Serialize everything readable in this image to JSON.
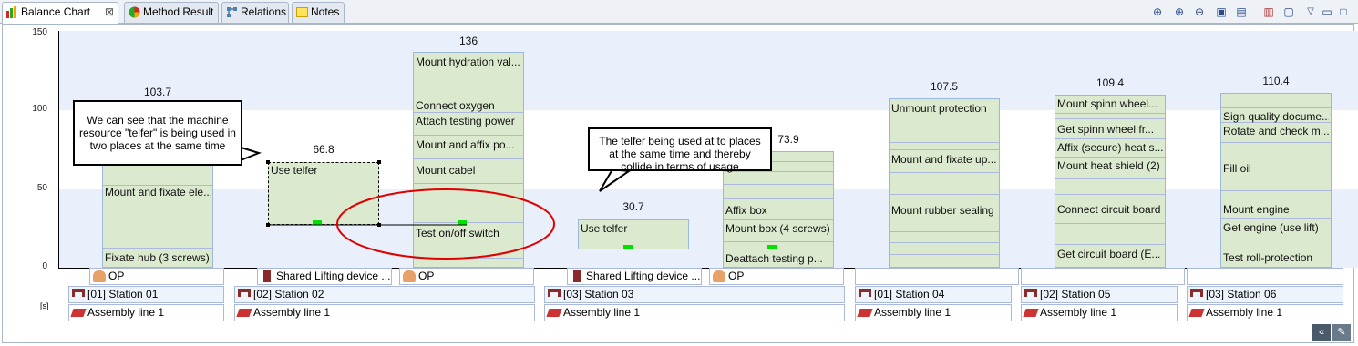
{
  "tabs": [
    {
      "label": "Balance Chart",
      "active": true,
      "icon": "balance-chart-icon",
      "closable": true
    },
    {
      "label": "Method Result",
      "active": false,
      "icon": "pie-chart-icon"
    },
    {
      "label": "Relations",
      "active": false,
      "icon": "relations-icon"
    },
    {
      "label": "Notes",
      "active": false,
      "icon": "note-icon"
    }
  ],
  "toolbar": {
    "icons": [
      "zoom-fit-icon",
      "zoom-in-icon",
      "zoom-out-icon",
      "next-icon",
      "export-icon",
      "chart-settings-icon",
      "print-icon",
      "view-menu-icon",
      "minimize-icon",
      "maximize-icon"
    ]
  },
  "yaxis": {
    "ticks": [
      "0",
      "50",
      "100",
      "150"
    ],
    "top_label": "150",
    "unit": "[s]"
  },
  "bars": [
    {
      "total": "103.7",
      "tasks": [
        "Mount and fixate ele...",
        "Fixate hub (3 screws)"
      ]
    },
    {
      "total": "66.8",
      "tasks": [
        "Use telfer"
      ]
    },
    {
      "total": "136",
      "tasks": [
        "Mount hydration val...",
        "Connect oxygen",
        "Attach testing power",
        "Mount and affix po...",
        "Mount cabel",
        "Test on/off switch"
      ]
    },
    {
      "total": "30.7",
      "tasks": [
        "Use telfer"
      ]
    },
    {
      "total": "73.9",
      "tasks": [
        "Affix box",
        "Mount box (4 screws)",
        "Deattach testing p..."
      ]
    },
    {
      "total": "107.5",
      "tasks": [
        "Unmount protection",
        "Mount and fixate up...",
        "Mount rubber sealing"
      ]
    },
    {
      "total": "109.4",
      "tasks": [
        "Mount spinn wheel...",
        "Get spinn wheel fr...",
        "Affix (secure) heat s...",
        "Mount heat shield (2)",
        "Connect circuit board",
        "Get circuit board (E..."
      ]
    },
    {
      "total": "110.4",
      "tasks": [
        "Sign quality docume...",
        "Rotate and check m...",
        "Fill oil",
        "Mount engine",
        "Get engine (use lift)",
        "Test roll-protection"
      ]
    }
  ],
  "resources": {
    "op": "OP",
    "shared": "Shared Lifting device ...",
    "op_icon": "operator-icon",
    "shared_icon": "lifting-device-icon"
  },
  "stations": [
    "[01] Station 01",
    "[02] Station 02",
    "[03] Station 03",
    "[01] Station 04",
    "[02] Station 05",
    "[03] Station 06"
  ],
  "station_icon": "station-icon",
  "line": "Assembly line 1",
  "line_icon": "assembly-line-icon",
  "callouts": {
    "left": "We can see that the machine resource \"telfer\" is being used in two places at the same time",
    "right": "The telfer being used at to places at the same time and thereby collide in terms of usage"
  },
  "colors": {
    "band": "#e9f0fb",
    "bar_fill": "#dbe9cf",
    "bar_border": "#9cb8d9",
    "marker": "#00e000",
    "highlight_ellipse": "#e00000"
  }
}
